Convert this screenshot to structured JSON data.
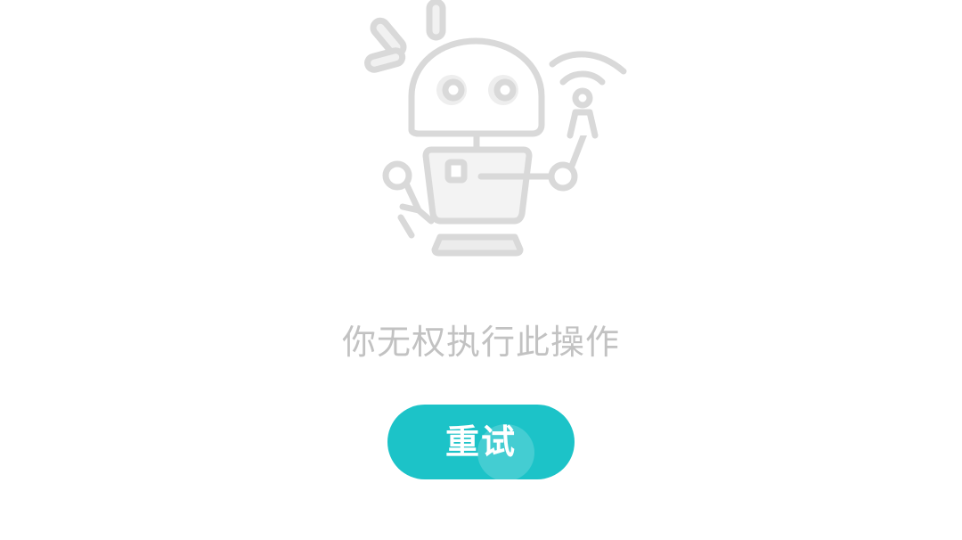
{
  "illustration": {
    "icon": "robot-wifi-icon",
    "stroke_color": "#d9d9d9",
    "fill_color": "#f3f3f3"
  },
  "message": {
    "text": "你无权执行此操作",
    "color": "#c2c2c2"
  },
  "retry_button": {
    "label": "重试",
    "background": "#1cc3c8",
    "text_color": "#ffffff"
  }
}
